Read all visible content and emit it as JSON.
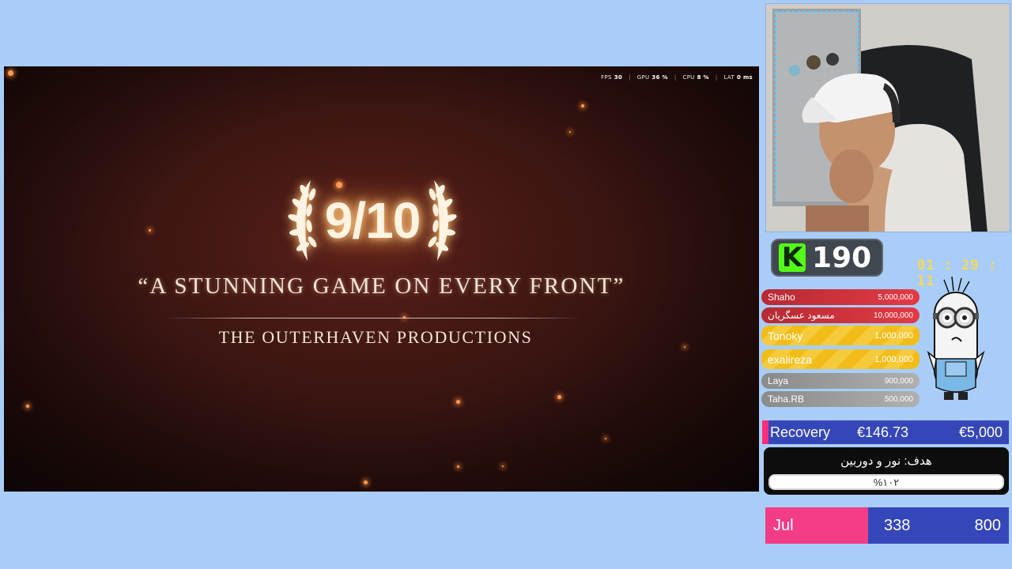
{
  "game": {
    "perf": [
      {
        "label": "FPS",
        "value": "30"
      },
      {
        "label": "GPU",
        "value": "36 %"
      },
      {
        "label": "CPU",
        "value": "8 %"
      },
      {
        "label": "LAT",
        "value": "0 ms"
      }
    ],
    "score": "9/10",
    "quote": "“A STUNNING GAME ON EVERY FRONT”",
    "source": "THE OUTERHAVEN PRODUCTIONS"
  },
  "kick": {
    "logo": "K",
    "viewers": "190"
  },
  "timer": "01 : 29 : 11",
  "donors": [
    {
      "name": "Shaho",
      "amount": "5,000,000",
      "tier": "red"
    },
    {
      "name": "مسعود عسگریان",
      "amount": "10,000,000",
      "tier": "red"
    },
    {
      "name": "Tonoky",
      "amount": "1,000,000",
      "tier": "gold"
    },
    {
      "name": "exalireza",
      "amount": "1,000,000",
      "tier": "gold"
    },
    {
      "name": "Laya",
      "amount": "900,000",
      "tier": "gray"
    },
    {
      "name": "Taha.RB",
      "amount": "500,000",
      "tier": "gray"
    }
  ],
  "recovery": {
    "label": "Recovery",
    "current": "€146.73",
    "goal": "€5,000"
  },
  "goal_widget": {
    "title": "هدف: نور و دوربین",
    "percent": "%۱۰۲",
    "progress": 1.0
  },
  "monthly": {
    "month": "Jul",
    "current": "338",
    "goal": "800"
  },
  "colors": {
    "background": "#a9cdf7",
    "kick_green": "#53fc18",
    "bar_blue": "#3547b8",
    "accent_pink": "#f23d86",
    "timer_yellow": "#f3d95a"
  }
}
